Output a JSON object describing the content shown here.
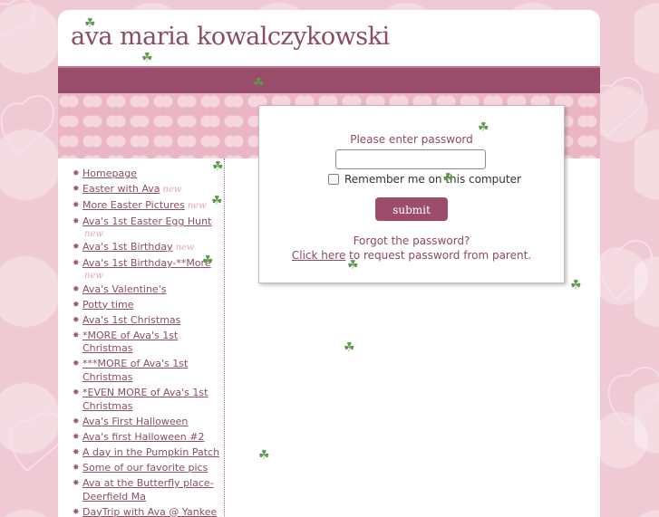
{
  "site": {
    "title": "ava maria kowalczykowski"
  },
  "nav": {
    "items": [
      {
        "label": "Homepage",
        "tag": ""
      },
      {
        "label": "Easter with Ava",
        "tag": "new"
      },
      {
        "label": "More Easter Pictures",
        "tag": "new"
      },
      {
        "label": "Ava's 1st Easter Egg Hunt",
        "tag": "new"
      },
      {
        "label": "Ava's 1st Birthday",
        "tag": "new"
      },
      {
        "label": "Ava's 1st Birthday-**More",
        "tag": "new"
      },
      {
        "label": "Ava's Valentine's",
        "tag": ""
      },
      {
        "label": "Potty time",
        "tag": ""
      },
      {
        "label": "Ava's 1st Christmas",
        "tag": ""
      },
      {
        "label": "*MORE of Ava's 1st Christmas",
        "tag": ""
      },
      {
        "label": "***MORE of Ava's 1st Christmas",
        "tag": ""
      },
      {
        "label": "*EVEN MORE of Ava's 1st Christmas",
        "tag": ""
      },
      {
        "label": "Ava's First Halloween",
        "tag": ""
      },
      {
        "label": "Ava's first Halloween #2",
        "tag": ""
      },
      {
        "label": "A day in the Pumpkin Patch",
        "tag": ""
      },
      {
        "label": "Some of our favorite pics",
        "tag": ""
      },
      {
        "label": "Ava at the Butterfly place-Deerfield Ma",
        "tag": ""
      },
      {
        "label": "DayTrip with Ava @ Yankee",
        "tag": ""
      }
    ],
    "bullet_icon": "sparkle-bullet-icon"
  },
  "login": {
    "prompt": "Please enter password",
    "password_value": "",
    "remember_label": "Remember me on this computer",
    "remember_checked": false,
    "submit_label": "submit",
    "forgot_text": "Forgot the password?",
    "click_here_label": "Click here",
    "request_text": " to request password from parent."
  },
  "colors": {
    "background": "#efc9d4",
    "band": "#9a4d6a",
    "accent": "#8c4a63",
    "button": "#9b4d6b",
    "clover": "#5c9a4a"
  },
  "decorations": {
    "clover_icon": "shamrock-icon"
  }
}
